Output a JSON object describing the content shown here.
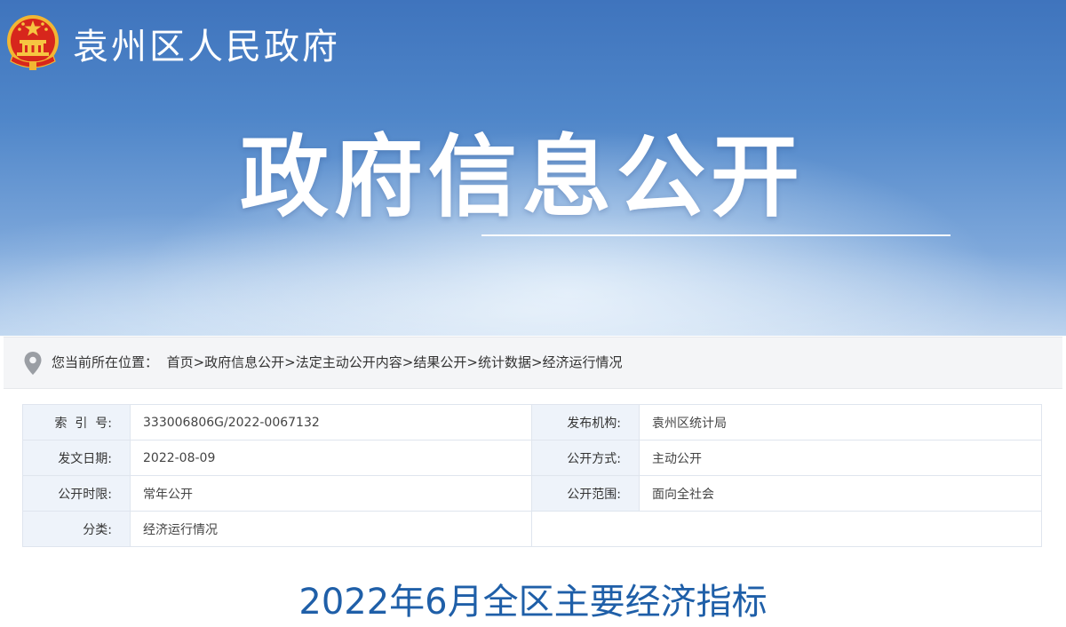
{
  "header": {
    "gov_name": "袁州区人民政府",
    "hero_title": "政府信息公开"
  },
  "breadcrumb": {
    "label": "您当前所在位置：",
    "items": [
      "首页",
      "政府信息公开",
      "法定主动公开内容",
      "结果公开",
      "统计数据",
      "经济运行情况"
    ],
    "separator": ">"
  },
  "meta": {
    "index_label": "索  引  号:",
    "index_value": "333006806G/2022-0067132",
    "org_label": "发布机构:",
    "org_value": "袁州区统计局",
    "date_label": "发文日期:",
    "date_value": "2022-08-09",
    "method_label": "公开方式:",
    "method_value": "主动公开",
    "period_label": "公开时限:",
    "period_value": "常年公开",
    "scope_label": "公开范围:",
    "scope_value": "面向全社会",
    "category_label": "分类:",
    "category_value": "经济运行情况"
  },
  "article": {
    "title": "2022年6月全区主要经济指标"
  },
  "colors": {
    "banner_top": "#3f74bd",
    "title_blue": "#1f5fa8",
    "label_bg": "#eef3fa",
    "emblem_red": "#d7261c",
    "emblem_gold": "#f6c541"
  },
  "icons": {
    "emblem": "national-emblem-icon",
    "location": "location-pin-icon"
  }
}
